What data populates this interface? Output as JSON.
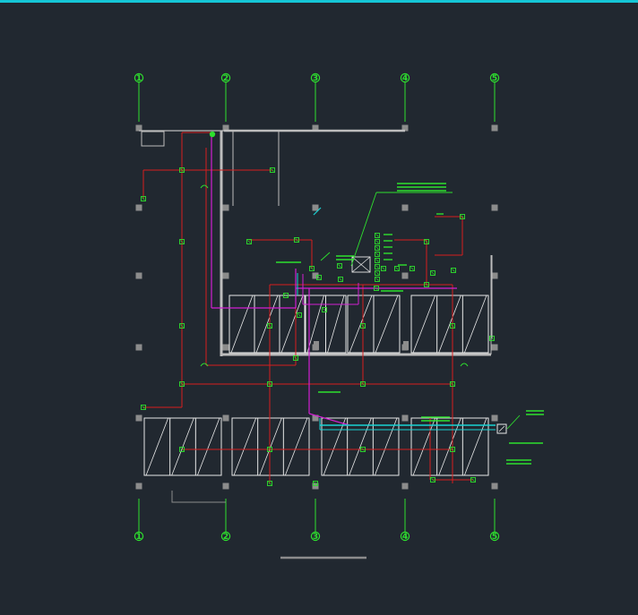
{
  "colors": {
    "background": "#212830",
    "top_rule": "#15c6d6",
    "grid_bubble": "#2ee02e",
    "wall": "#bdbdbd",
    "column": "#8c8c8c",
    "red_pipe": "#d81e1e",
    "magenta_pipe": "#d21fd2",
    "cyan_pipe": "#19d3d3",
    "green_device": "#2ee02e",
    "white_frame": "#e8e8e8"
  },
  "grid": {
    "top_labels": [
      "1",
      "2",
      "3",
      "4",
      "5"
    ],
    "bottom_labels": [
      "1",
      "2",
      "3",
      "4",
      "5"
    ]
  },
  "icons": {
    "grid_bubble": "grid-bubble-icon",
    "device": "detector-icon",
    "equipment": "cabinet-icon"
  }
}
